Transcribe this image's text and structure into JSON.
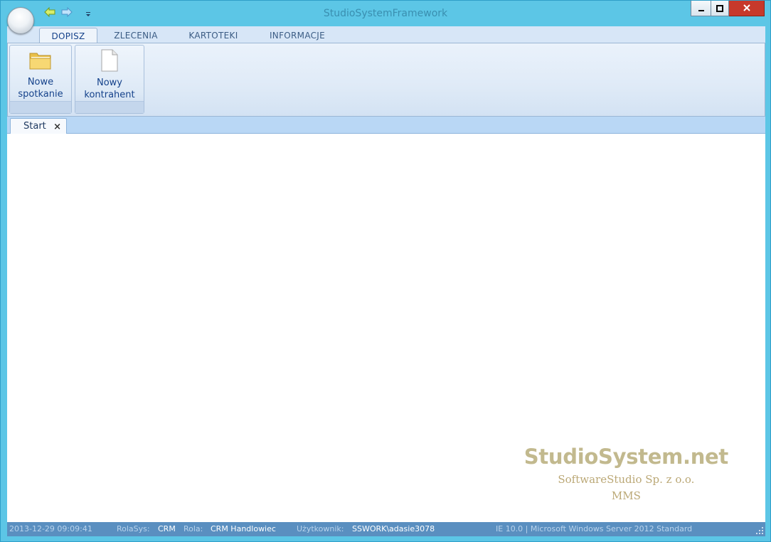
{
  "window": {
    "title": "StudioSystemFramework"
  },
  "quick_access": {
    "back_icon": "arrow-left-icon",
    "forward_icon": "arrow-right-icon",
    "customize_icon": "dropdown-arrow-icon"
  },
  "ribbon": {
    "tabs": [
      {
        "label": "DOPISZ",
        "active": true
      },
      {
        "label": "ZLECENIA",
        "active": false
      },
      {
        "label": "KARTOTEKI",
        "active": false
      },
      {
        "label": "INFORMACJE",
        "active": false
      }
    ],
    "buttons": [
      {
        "label_line1": "Nowe",
        "label_line2": "spotkanie",
        "icon": "folder-icon"
      },
      {
        "label_line1": "Nowy",
        "label_line2": "kontrahent",
        "icon": "document-icon"
      }
    ]
  },
  "document_tabs": [
    {
      "label": "Start",
      "close": "×"
    }
  ],
  "branding": {
    "name": "StudioSystem.net",
    "company": "SoftwareStudio Sp. z o.o.",
    "product": "MMS"
  },
  "status_bar": {
    "datetime": "2013-12-29 09:09:41",
    "rolasys_label": "RolaSys:",
    "rolasys_value": "CRM",
    "rola_label": "Rola:",
    "rola_value": "CRM Handlowiec",
    "user_label": "Użytkownik:",
    "user_value": "SSWORK\\adasie3078",
    "system_info": "IE 10.0 | Microsoft Windows Server 2012 Standard"
  },
  "colors": {
    "frame": "#5cc6e6",
    "ribbon_text": "#15428b",
    "brand_gold": "#c2b98e",
    "status_bg": "#5a8fc0",
    "close_red": "#c7392b"
  }
}
